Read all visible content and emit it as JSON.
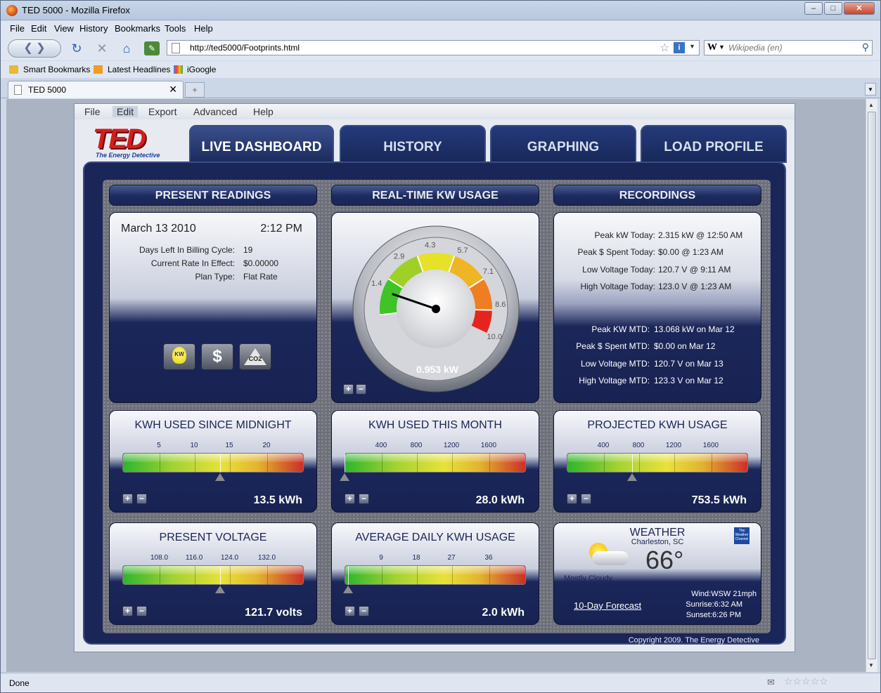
{
  "browser": {
    "window_title": "TED 5000 - Mozilla Firefox",
    "menu": [
      "File",
      "Edit",
      "View",
      "History",
      "Bookmarks",
      "Tools",
      "Help"
    ],
    "url": "http://ted5000/Footprints.html",
    "search_placeholder": "Wikipedia (en)",
    "bookmarks": [
      "Smart Bookmarks",
      "Latest Headlines",
      "iGoogle"
    ],
    "tab_title": "TED 5000",
    "status": "Done"
  },
  "app": {
    "menu": [
      "File",
      "Edit",
      "Export",
      "Advanced",
      "Help"
    ],
    "logo_text": "TED",
    "logo_tagline": "The Energy Detective",
    "tabs": [
      "LIVE DASHBOARD",
      "HISTORY",
      "GRAPHING",
      "LOAD PROFILE"
    ],
    "copyright": "Copyright 2009. The Energy Detective"
  },
  "headers": [
    "PRESENT READINGS",
    "REAL-TIME KW USAGE",
    "RECORDINGS"
  ],
  "present": {
    "date": "March 13 2010",
    "time": "2:12 PM",
    "rows": [
      {
        "label": "Days Left In Billing Cycle:",
        "value": "19"
      },
      {
        "label": "Current Rate In Effect:",
        "value": "$0.00000"
      },
      {
        "label": "Plan Type:",
        "value": "Flat Rate"
      }
    ],
    "buttons": [
      "KW",
      "$",
      "CO2"
    ]
  },
  "gauge": {
    "value_kw": 0.953,
    "label": "0.953 kW",
    "min": 0,
    "max": 10,
    "ticks": [
      "1.4",
      "2.9",
      "4.3",
      "5.7",
      "7.1",
      "8.6",
      "10.0"
    ]
  },
  "recordings": {
    "today": [
      {
        "label": "Peak kW Today:",
        "value": "2.315 kW @ 12:50 AM"
      },
      {
        "label": "Peak $ Spent Today:",
        "value": "$0.00 @ 1:23 AM"
      },
      {
        "label": "Low Voltage Today:",
        "value": "120.7 V @ 9:11 AM"
      },
      {
        "label": "High Voltage Today:",
        "value": "123.0 V @ 1:23 AM"
      }
    ],
    "mtd": [
      {
        "label": "Peak KW MTD:",
        "value": "13.068 kW on Mar 12"
      },
      {
        "label": "Peak $ Spent MTD:",
        "value": "$0.00 on Mar 12"
      },
      {
        "label": "Low Voltage MTD:",
        "value": "120.7 V on Mar 13"
      },
      {
        "label": "High Voltage MTD:",
        "value": "123.3 V on Mar 12"
      }
    ]
  },
  "meters": [
    {
      "title": "KWH USED SINCE MIDNIGHT",
      "ticks": [
        "5",
        "10",
        "15",
        "20"
      ],
      "value": "13.5 kWh",
      "level": 0.54
    },
    {
      "title": "KWH USED THIS MONTH",
      "ticks": [
        "400",
        "800",
        "1200",
        "1600"
      ],
      "value": "28.0 kWh",
      "level": 0.0
    },
    {
      "title": "PROJECTED KWH USAGE",
      "ticks": [
        "400",
        "800",
        "1200",
        "1600"
      ],
      "value": "753.5 kWh",
      "level": 0.36
    },
    {
      "title": "PRESENT VOLTAGE",
      "ticks": [
        "108.0",
        "116.0",
        "124.0",
        "132.0"
      ],
      "value": "121.7 volts",
      "level": 0.54
    },
    {
      "title": "AVERAGE DAILY KWH USAGE",
      "ticks": [
        "9",
        "18",
        "27",
        "36"
      ],
      "value": "2.0 kWh",
      "level": 0.02
    }
  ],
  "weather": {
    "title": "WEATHER",
    "location": "Charleston, SC",
    "temp": "66°",
    "condition": "Mostly Cloudy",
    "forecast_link": "10-Day Forecast",
    "wind": "Wind:WSW 21mph",
    "sunrise": "Sunrise:6:32 AM",
    "sunset": "Sunset:6:26 PM",
    "logo": "The Weather Channel"
  }
}
